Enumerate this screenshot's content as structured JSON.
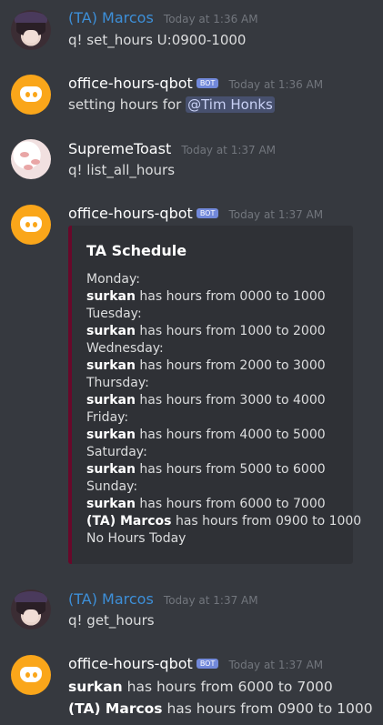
{
  "messages": [
    {
      "author": "(TA) Marcos",
      "timestamp": "Today at 1:36 AM",
      "text": "q! set_hours U:0900-1000"
    },
    {
      "author": "office-hours-qbot",
      "badge": "BOT",
      "timestamp": "Today at 1:36 AM",
      "text_prefix": "setting hours for ",
      "mention": "@Tim Honks"
    },
    {
      "author": "SupremeToast",
      "timestamp": "Today at 1:37 AM",
      "text": "q! list_all_hours"
    },
    {
      "author": "office-hours-qbot",
      "badge": "BOT",
      "timestamp": "Today at 1:37 AM",
      "embed": {
        "title": "TA Schedule",
        "lines": [
          {
            "text": "Monday:"
          },
          {
            "bold": "surkan",
            "text": " has hours from 0000 to 1000"
          },
          {
            "text": "Tuesday:"
          },
          {
            "bold": "surkan",
            "text": " has hours from 1000 to 2000"
          },
          {
            "text": "Wednesday:"
          },
          {
            "bold": "surkan",
            "text": " has hours from 2000 to 3000"
          },
          {
            "text": "Thursday:"
          },
          {
            "bold": "surkan",
            "text": " has hours from 3000 to 4000"
          },
          {
            "text": "Friday:"
          },
          {
            "bold": "surkan",
            "text": " has hours from 4000 to 5000"
          },
          {
            "text": "Saturday:"
          },
          {
            "bold": "surkan",
            "text": " has hours from 5000 to 6000"
          },
          {
            "text": "Sunday:"
          },
          {
            "bold": "surkan",
            "text": " has hours from 6000 to 7000"
          },
          {
            "bold": "(TA) Marcos",
            "text": " has hours from 0900 to 1000"
          },
          {
            "text": "No Hours Today"
          }
        ]
      }
    },
    {
      "author": "(TA) Marcos",
      "timestamp": "Today at 1:37 AM",
      "text": "q! get_hours"
    },
    {
      "author": "office-hours-qbot",
      "badge": "BOT",
      "timestamp": "Today at 1:37 AM",
      "lines": [
        {
          "bold": "surkan",
          "text": " has hours from 6000 to 7000"
        },
        {
          "bold": "(TA) Marcos",
          "text": " has hours from 0900 to 1000"
        }
      ]
    }
  ],
  "colors": {
    "background": "#36393f",
    "ta_name": "#3d8fd8",
    "bot_badge": "#7289da",
    "embed_bar": "#68082a",
    "bot_avatar": "#faa61a"
  }
}
